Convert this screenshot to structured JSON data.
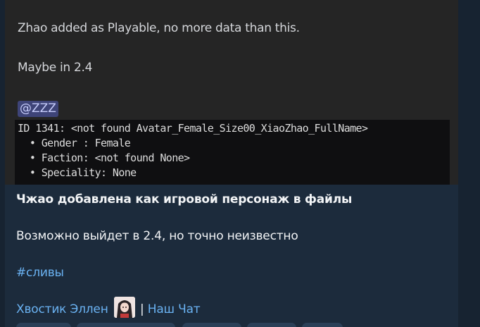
{
  "screenshot": {
    "line1": "Zhao added as Playable, no more data than this.",
    "line2": "Maybe in 2.4",
    "mention": "@ZZZ",
    "code": [
      "ID 1341: <not found Avatar_Female_Size00_XiaoZhao_FullName>",
      "  • Gender : Female",
      "  • Faction: <not found None>",
      "  • Speciality: None"
    ]
  },
  "message": {
    "headline": "Чжао добавлена как игровой персонаж в файлы",
    "body": "Возможно выйдет в 2.4, но точно неизвестно",
    "hashtag": "#сливы",
    "channel_link": "Хвостик Эллен",
    "separator": "|",
    "chat_link": "Наш Чат"
  },
  "colors": {
    "link": "#6ab2f2",
    "bubble": "#1c2b3c",
    "mention_bg": "#3e4478"
  }
}
